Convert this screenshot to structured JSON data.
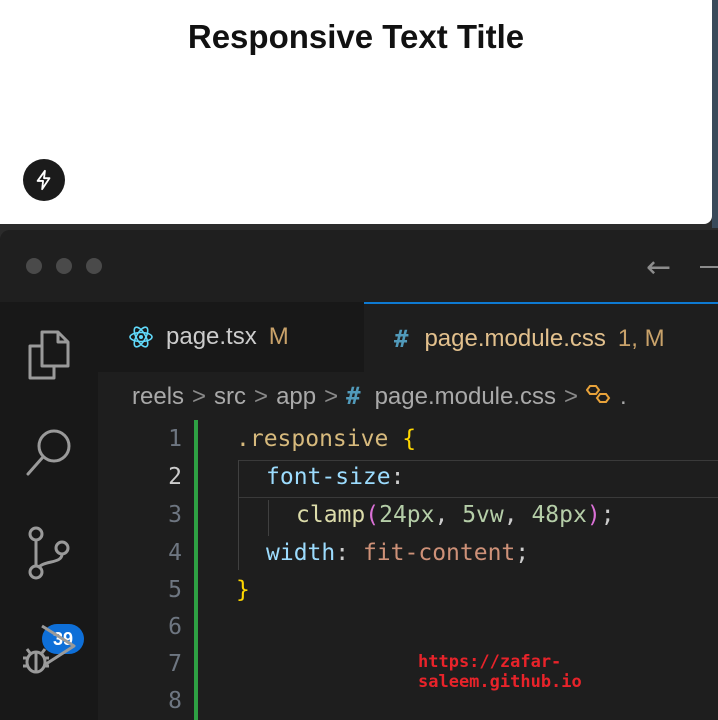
{
  "preview": {
    "title": "Responsive Text Title"
  },
  "editor": {
    "tabs": [
      {
        "name": "page.tsx",
        "status": "M"
      },
      {
        "name": "page.module.css",
        "status": "1, M"
      }
    ],
    "breadcrumb": [
      "reels",
      "src",
      "app",
      "page.module.css"
    ],
    "breadcrumb_more": ".",
    "source_control_badge": "39",
    "line_numbers": [
      "1",
      "2",
      "3",
      "4",
      "5",
      "6",
      "7",
      "8"
    ],
    "code": {
      "selector": ".responsive",
      "open_brace": "{",
      "close_brace": "}",
      "prop_font_size": "font-size",
      "fn_clamp": "clamp",
      "clamp_arg1": "24px",
      "clamp_arg2": "5vw",
      "clamp_arg3": "48px",
      "prop_width": "width",
      "width_value": "fit-content"
    }
  },
  "watermark": "https://zafar-saleem.github.io",
  "colors": {
    "accent": "#0e7ad2",
    "badge": "#0e6fd8",
    "modified": "#2ea043"
  },
  "icons": [
    "bolt-icon",
    "explorer-icon",
    "search-icon",
    "source-control-icon",
    "run-debug-icon",
    "react-icon",
    "css-file-icon",
    "symbol-icon",
    "arrow-left-icon"
  ]
}
